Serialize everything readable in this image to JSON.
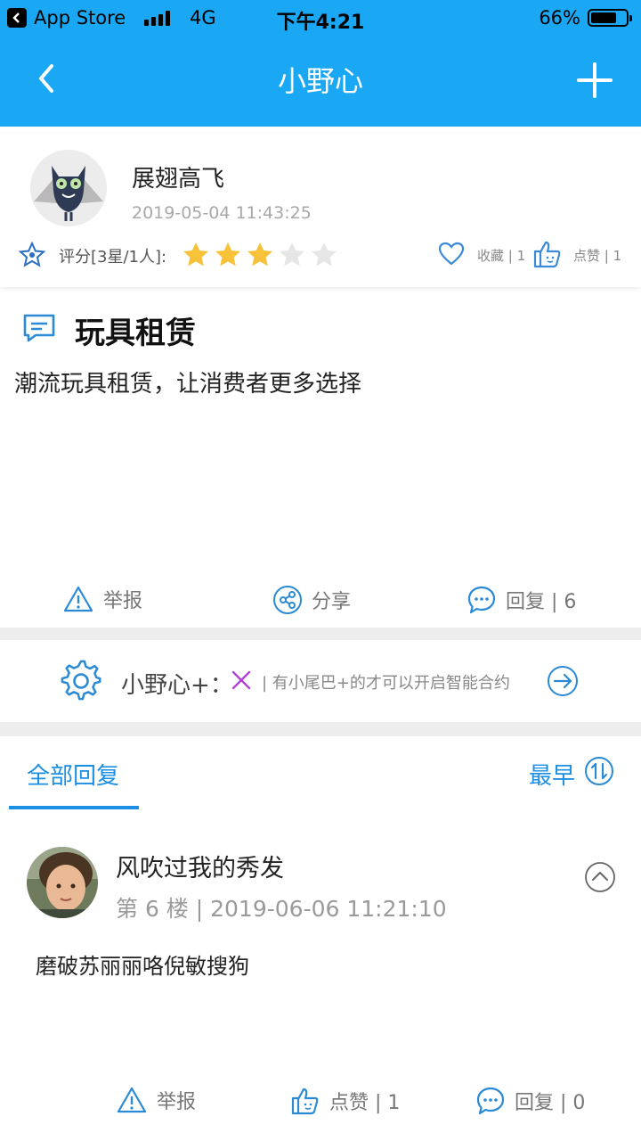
{
  "status_bar": {
    "back_app": "App Store",
    "network": "4G",
    "time": "下午4:21",
    "battery": "66%"
  },
  "nav": {
    "title": "小野心"
  },
  "post": {
    "author": "展翅高飞",
    "time": "2019-05-04 11:43:25",
    "rating_label": "评分[3星/1人]:",
    "rating": 3,
    "rating_max": 5,
    "favorite_label": "收藏 | 1",
    "like_label": "点赞 | 1",
    "title": "玩具租赁",
    "body": "潮流玩具租赁，让消费者更多选择",
    "actions": {
      "report": "举报",
      "share": "分享",
      "reply": "回复 | 6"
    }
  },
  "contract": {
    "label": "小野心+：",
    "hint": "| 有小尾巴+的才可以开启智能合约"
  },
  "tabs": {
    "all": "全部回复",
    "sort": "最早"
  },
  "reply": {
    "author": "风吹过我的秀发",
    "meta": "第 6 楼 | 2019-06-06 11:21:10",
    "body": "磨破苏丽丽咯倪敏搜狗",
    "actions": {
      "report": "举报",
      "like": "点赞 | 1",
      "reply": "回复 | 0"
    }
  },
  "colors": {
    "header": "#1aa7f3",
    "accent": "#1a8fe3",
    "star": "#f7c23a",
    "star_empty": "#e6e6e6"
  }
}
